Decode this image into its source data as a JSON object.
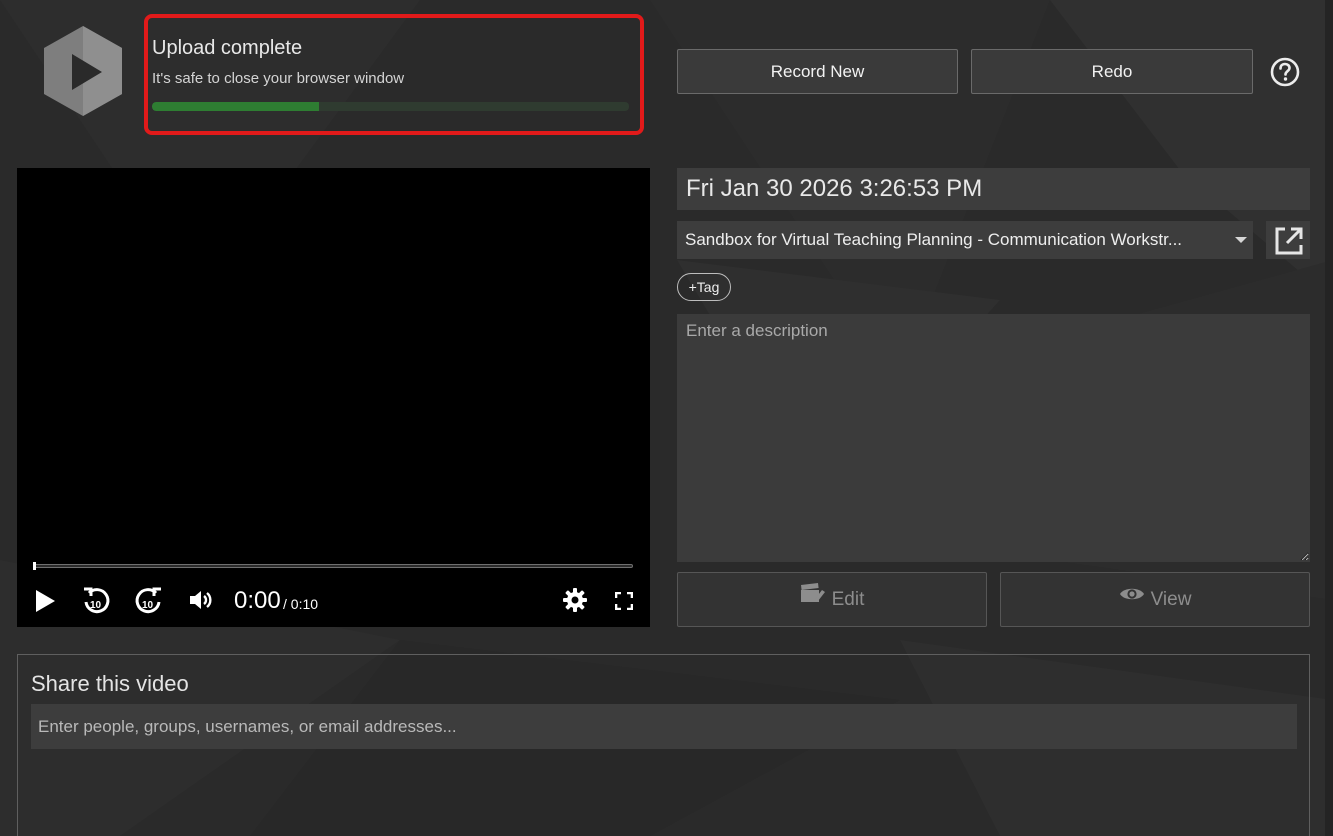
{
  "upload": {
    "title": "Upload complete",
    "subtitle": "It's safe to close your browser window",
    "progress_fraction": 0.35,
    "progress_color": "#2e7d32"
  },
  "header": {
    "record_new_label": "Record New",
    "redo_label": "Redo",
    "help_icon": "help-circle-icon"
  },
  "player": {
    "current_time": "0:00",
    "total_time": "/ 0:10",
    "icons": [
      "play-icon",
      "rewind-10-icon",
      "forward-10-icon",
      "volume-icon",
      "gear-icon",
      "fullscreen-icon"
    ]
  },
  "details": {
    "title_value": "Fri Jan 30 2026 3:26:53 PM",
    "folder_value": "Sandbox for Virtual Teaching Planning - Communication Workstr...",
    "tag_label": "+Tag",
    "description_placeholder": "Enter a description",
    "edit_label": "Edit",
    "view_label": "View"
  },
  "share": {
    "title": "Share this video",
    "input_placeholder": "Enter people, groups, usernames, or email addresses..."
  },
  "colors": {
    "background": "#2a2a2a",
    "highlight_border": "#e11a1a",
    "field_bg": "#3d3d3d"
  }
}
